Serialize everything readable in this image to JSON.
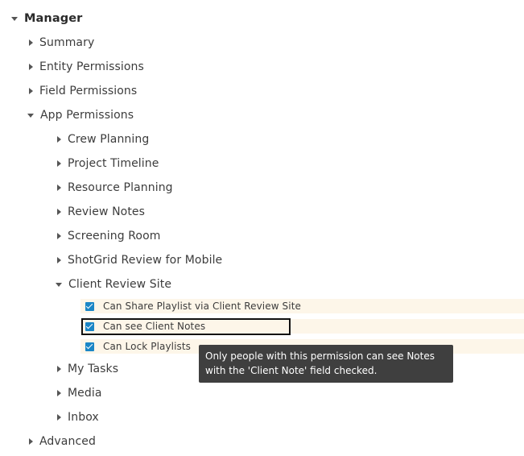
{
  "tree": {
    "root": {
      "label": "Manager",
      "expanded": true
    },
    "items": [
      {
        "label": "Summary"
      },
      {
        "label": "Entity Permissions"
      },
      {
        "label": "Field Permissions"
      },
      {
        "label": "App Permissions",
        "expanded": true
      }
    ],
    "app_permissions": [
      {
        "label": "Crew Planning"
      },
      {
        "label": "Project Timeline"
      },
      {
        "label": "Resource Planning"
      },
      {
        "label": "Review Notes"
      },
      {
        "label": "Screening Room"
      },
      {
        "label": "ShotGrid Review for Mobile"
      },
      {
        "label": "Client Review Site",
        "expanded": true
      }
    ],
    "client_review_site_permissions": [
      {
        "label": "Can Share Playlist via Client Review Site",
        "checked": true
      },
      {
        "label": "Can see Client Notes",
        "checked": true,
        "focused": true
      },
      {
        "label": "Can Lock Playlists",
        "checked": true
      }
    ],
    "app_permissions_after": [
      {
        "label": "My Tasks"
      },
      {
        "label": "Media"
      },
      {
        "label": "Inbox"
      }
    ],
    "last_item": {
      "label": "Advanced"
    }
  },
  "tooltip": {
    "text": "Only people with this permission can see Notes with the 'Client Note' field checked."
  },
  "colors": {
    "checkbox": "#1b86c6",
    "permission_row_bg": "#fdf6e9",
    "tooltip_bg": "#3f3f3f"
  }
}
